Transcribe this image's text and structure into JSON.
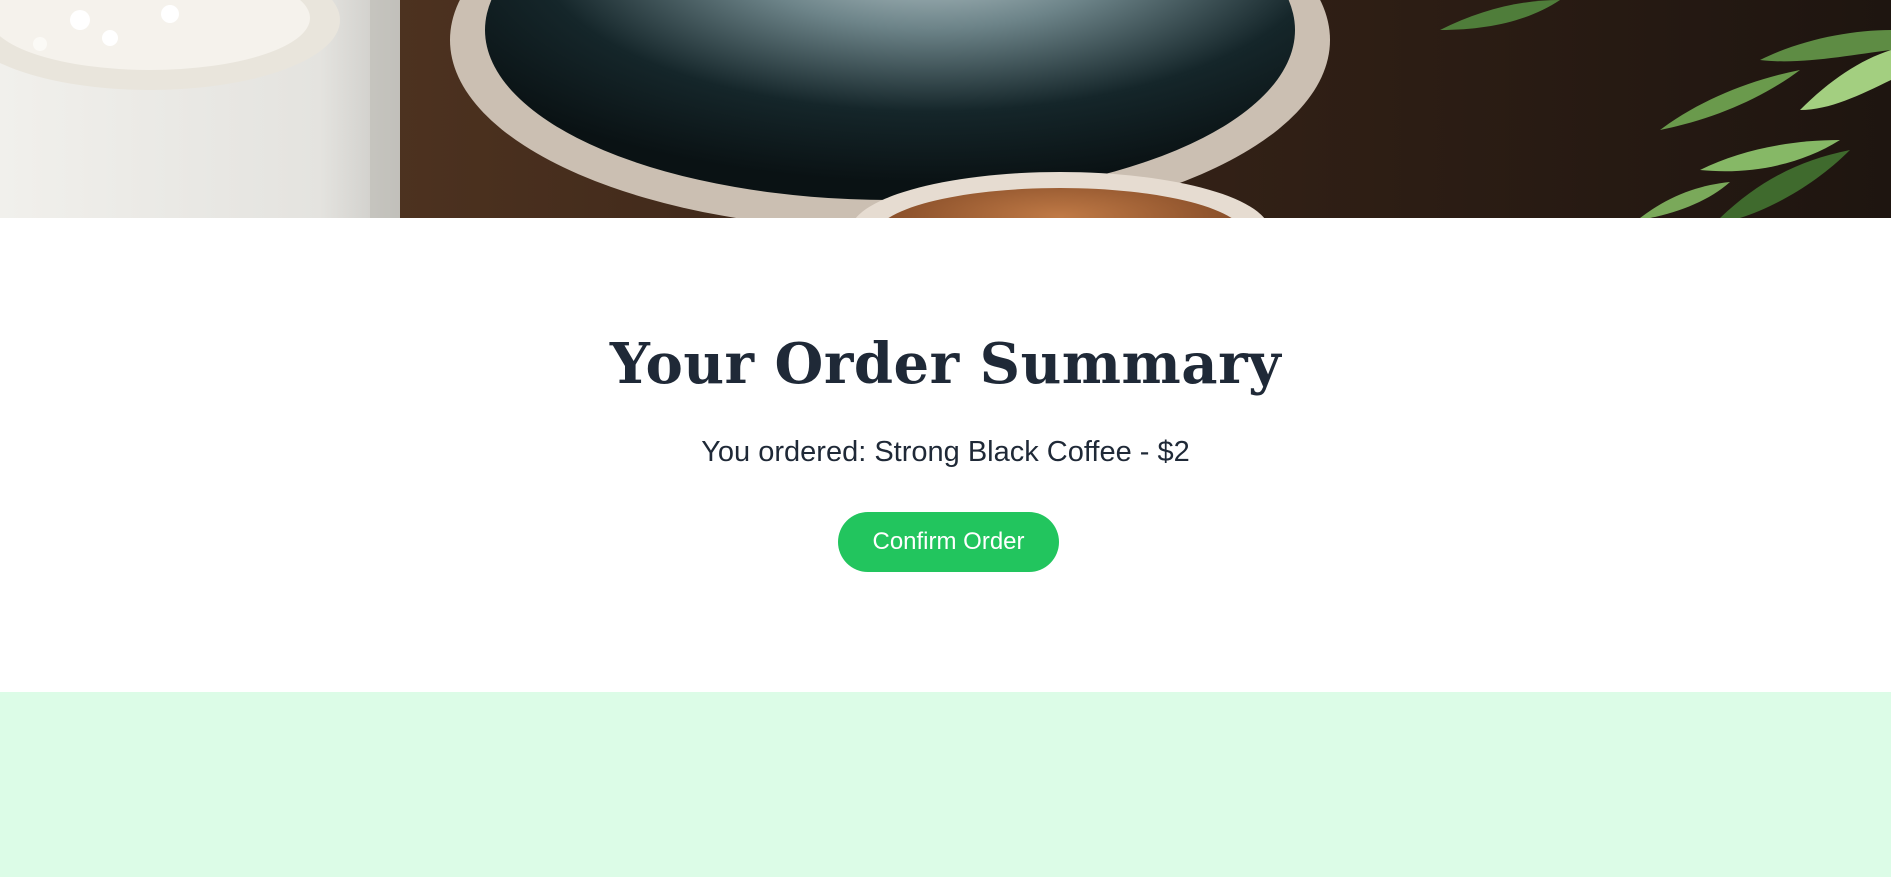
{
  "hero": {
    "image": "coffee-cups-photo",
    "colors": {
      "table": "#3a2a1f",
      "cup_rim": "#d9cfc4",
      "coffee_dark": "#0d1618",
      "crema": "#a0623a",
      "plant": "#4f7d3a"
    }
  },
  "summary": {
    "title": "Your Order Summary",
    "order_line": "You ordered: Strong Black Coffee - $2",
    "confirm_label": "Confirm Order"
  },
  "colors": {
    "heading": "#1f2937",
    "button": "#22c55e",
    "button_text": "#ffffff",
    "footer_band": "#dcfce7",
    "background": "#ffffff"
  }
}
